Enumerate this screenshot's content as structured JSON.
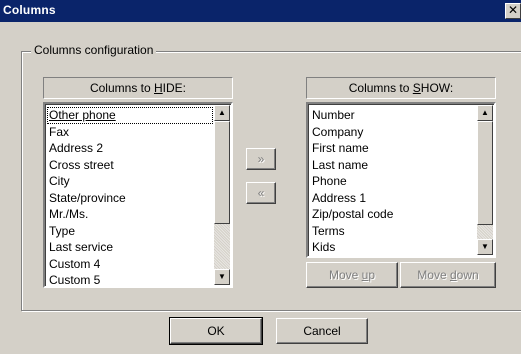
{
  "window": {
    "title": "Columns",
    "close_glyph": "✕"
  },
  "group": {
    "label": "Columns configuration"
  },
  "hide": {
    "header_pre": "Columns to ",
    "header_key": "H",
    "header_post": "IDE:",
    "items": [
      "Other phone",
      "Fax",
      "Address 2",
      "Cross street",
      "City",
      "State/province",
      "Mr./Ms.",
      "Type",
      "Last service",
      "Custom 4",
      "Custom 5"
    ],
    "selected_index": 0
  },
  "show": {
    "header_pre": "Columns to ",
    "header_key": "S",
    "header_post": "HOW:",
    "items": [
      "Number",
      "Company",
      "First name",
      "Last name",
      "Phone",
      "Address 1",
      "Zip/postal code",
      "Terms",
      "Kids"
    ]
  },
  "buttons": {
    "add": "»",
    "remove": "«",
    "move_up_pre": "Move ",
    "move_up_key": "u",
    "move_up_post": "p",
    "move_down_pre": "Move ",
    "move_down_key": "d",
    "move_down_post": "own",
    "ok": "OK",
    "cancel": "Cancel"
  },
  "icons": {
    "scroll_up": "arrow-up-icon",
    "scroll_down": "arrow-down-icon",
    "up_glyph": "▲",
    "down_glyph": "▼"
  }
}
